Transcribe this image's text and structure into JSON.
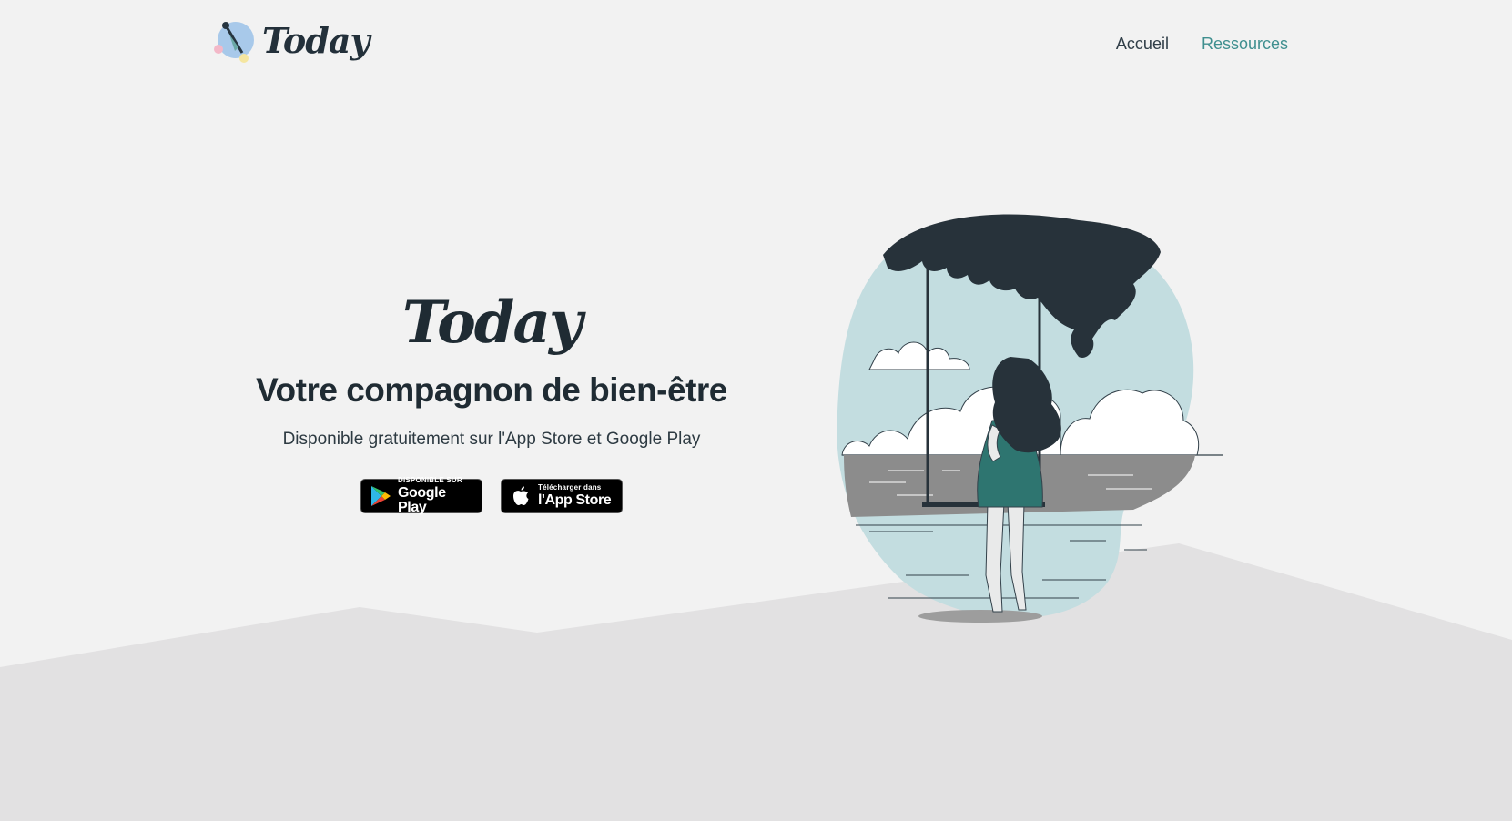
{
  "header": {
    "brand_name": "Today",
    "nav": [
      {
        "label": "Accueil"
      },
      {
        "label": "Ressources"
      }
    ]
  },
  "hero": {
    "title": "Today",
    "subtitle": "Votre compagnon de bien-être",
    "text": "Disponible gratuitement sur l'App Store et Google Play",
    "google_play": {
      "small": "DISPONIBLE SUR",
      "big": "Google Play"
    },
    "app_store": {
      "small": "Télécharger dans",
      "big": "l'App Store"
    }
  },
  "colors": {
    "background": "#f2f2f2",
    "ground": "#e2e1e2",
    "text_dark": "#1f2b33",
    "accent_teal": "#3f8f8f",
    "sky_blob": "#c3dde0",
    "sea": "#8c8c8c",
    "dress": "#2e7570",
    "foliage": "#27323a"
  },
  "icons": {
    "brand_logo": "girl-logo-icon",
    "google_play": "google-play-triangle-icon",
    "app_store": "apple-icon"
  }
}
